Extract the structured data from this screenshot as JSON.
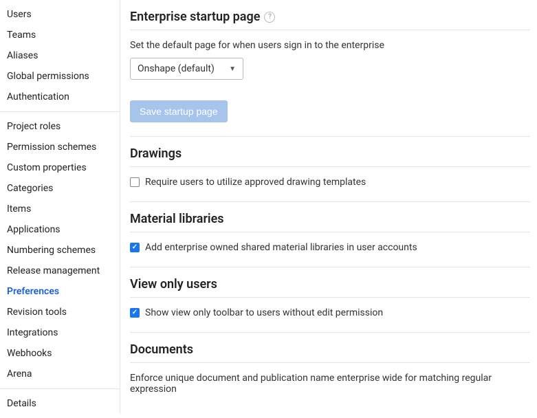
{
  "sidebar": {
    "groups": [
      {
        "items": [
          {
            "label": "Users",
            "active": false
          },
          {
            "label": "Teams",
            "active": false
          },
          {
            "label": "Aliases",
            "active": false
          },
          {
            "label": "Global permissions",
            "active": false
          },
          {
            "label": "Authentication",
            "active": false
          }
        ]
      },
      {
        "items": [
          {
            "label": "Project roles",
            "active": false
          },
          {
            "label": "Permission schemes",
            "active": false
          },
          {
            "label": "Custom properties",
            "active": false
          },
          {
            "label": "Categories",
            "active": false
          },
          {
            "label": "Items",
            "active": false
          },
          {
            "label": "Applications",
            "active": false
          },
          {
            "label": "Numbering schemes",
            "active": false
          },
          {
            "label": "Release management",
            "active": false
          },
          {
            "label": "Preferences",
            "active": true
          },
          {
            "label": "Revision tools",
            "active": false
          },
          {
            "label": "Integrations",
            "active": false
          },
          {
            "label": "Webhooks",
            "active": false
          },
          {
            "label": "Arena",
            "active": false
          }
        ]
      },
      {
        "items": [
          {
            "label": "Details",
            "active": false
          }
        ]
      }
    ]
  },
  "main": {
    "startup": {
      "title": "Enterprise startup page",
      "help_icon": "?",
      "description": "Set the default page for when users sign in to the enterprise",
      "selected_option": "Onshape (default)",
      "save_button": "Save startup page"
    },
    "drawings": {
      "title": "Drawings",
      "checkbox_label": "Require users to utilize approved drawing templates",
      "checked": false
    },
    "material": {
      "title": "Material libraries",
      "checkbox_label": "Add enterprise owned shared material libraries in user accounts",
      "checked": true
    },
    "viewonly": {
      "title": "View only users",
      "checkbox_label": "Show view only toolbar to users without edit permission",
      "checked": true
    },
    "documents": {
      "title": "Documents",
      "description": "Enforce unique document and publication name enterprise wide for matching regular expression"
    }
  }
}
